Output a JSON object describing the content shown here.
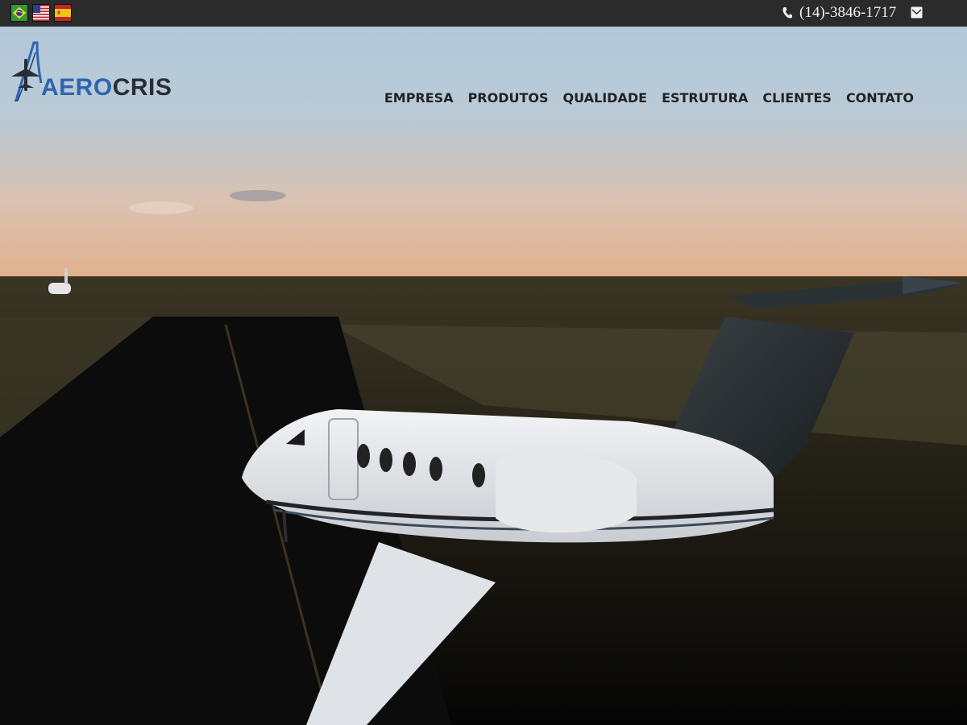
{
  "languages": [
    {
      "code": "pt-BR",
      "icon": "brazil-flag-icon"
    },
    {
      "code": "en-US",
      "icon": "usa-flag-icon"
    },
    {
      "code": "es",
      "icon": "spain-flag-icon"
    }
  ],
  "contact": {
    "phone": "(14)-3846-1717",
    "phone_icon": "phone-icon",
    "email_icon": "mail-icon"
  },
  "brand": {
    "logo_part1": "AERO",
    "logo_part2": "CRIS",
    "logo_icon": "airplane-logo-icon",
    "colors": {
      "blue": "#2e64b0",
      "dark": "#2a2d36"
    }
  },
  "nav": {
    "items": [
      {
        "label": "EMPRESA"
      },
      {
        "label": "PRODUTOS"
      },
      {
        "label": "QUALIDADE"
      },
      {
        "label": "ESTRUTURA"
      },
      {
        "label": "CLIENTES"
      },
      {
        "label": "CONTATO"
      }
    ]
  },
  "hero": {
    "image": "business jet on runway at dusk"
  }
}
